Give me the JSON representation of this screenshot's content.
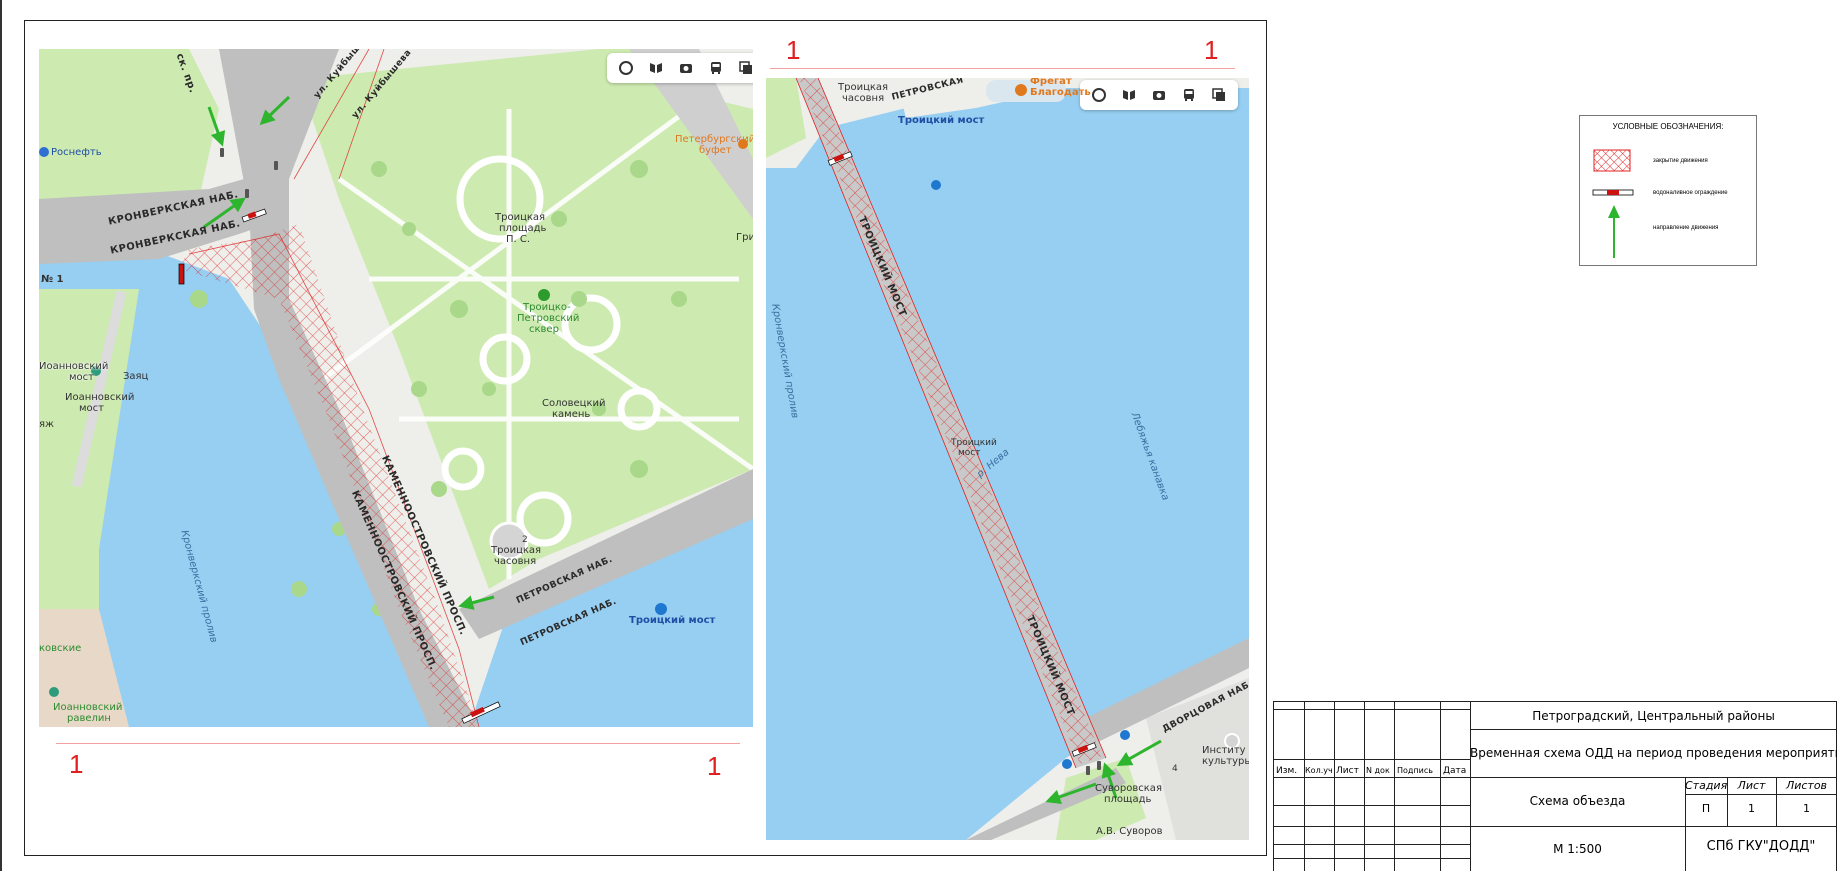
{
  "drawing": {
    "section_marks": {
      "top_left": "1",
      "top_right": "1",
      "bottom_left": "1",
      "bottom_right": "1"
    }
  },
  "map_controls": [
    "traffic-layer-icon",
    "panorama-icon",
    "photo-icon",
    "transit-icon",
    "layers-icon"
  ],
  "map_left": {
    "labels": {
      "kronverk_pr": "ск. пр.",
      "kuibysheva_1": "ул. Куйбышева",
      "kuibysheva_2": "ул. Куйбышева",
      "rosneft": "Роснефть",
      "petersburg_buffet_1": "Петербургский",
      "petersburg_buffet_2": "буфет",
      "gri": "Гри",
      "kronverk_nab_1": "КРОНВЕРКСКАЯ НАБ.",
      "kronverk_nab_2": "КРОНВЕРКСКАЯ НАБ.",
      "n1": "№ 1",
      "troitskaya_pl_1": "Троицкая",
      "troitskaya_pl_2": "площадь",
      "troitskaya_pl_3": "П. С.",
      "skver_1": "Троицко-",
      "skver_2": "Петровский",
      "skver_3": "сквер",
      "ioann_bridge_1": "Иоанновский",
      "ioann_bridge_2": "мост",
      "zayats": "Заяц",
      "ioann_most_1": "Иоанновский",
      "ioann_most_2": "мост",
      "yazh": "яж",
      "solovetsky_1": "Соловецкий",
      "solovetsky_2": "камень",
      "kronverk_proliv": "Кронверкский пролив",
      "kamennoostr_1": "КАМЕННООСТРОВСКИЙ ПРОСП.",
      "kamennoostr_2": "КАМЕННООСТРОВСКИЙ ПРОСП.",
      "chasovnya_1": "Троицкая",
      "chasovnya_2": "часовня",
      "petrovskaya_1": "ПЕТРОВСКАЯ НАБ.",
      "petrovskaya_2": "ПЕТРОВСКАЯ НАБ.",
      "troitsky_bridge": "Троицкий мост",
      "kronverkskie": "ковские",
      "ravelin_1": "Иоанновский",
      "ravelin_2": "равелин",
      "badge2": "2"
    }
  },
  "map_right": {
    "labels": {
      "chasovnya_1": "Троицкая",
      "chasovnya_2": "часовня",
      "petrovskaya": "ПЕТРОВСКАЯ",
      "fregat_1": "Фрегат",
      "fregat_2": "Благодать",
      "troitsky_bridge_top": "Троицкий мост",
      "bridge_upper": "ТРОИЦКИЙ МОСТ",
      "bridge_lower": "ТРОИЦКИЙ МОСТ",
      "kronverk_proliv": "Кронверкский пролив",
      "bridge_mid_1": "Троицкий",
      "bridge_mid_2": "мост",
      "neva": "р. Нева",
      "lebyazhya": "Лебяжья канавка",
      "dvortsovaya": "ДВОРЦОВАЯ НАБ.",
      "institut_1": "Институ",
      "institut_2": "культуры",
      "suvorov_pl_1": "Суворовская",
      "suvorov_pl_2": "площадь",
      "suvorov": "А.В. Суворов",
      "badge4": "4"
    }
  },
  "legend": {
    "title": "УСЛОВНЫЕ ОБОЗНАЧЕНИЯ:",
    "items": [
      {
        "label": "закрытие движения"
      },
      {
        "label": "водоналивное ограждение"
      },
      {
        "label": "направление движения"
      }
    ],
    "colors": {
      "closure": "#e02020",
      "arrow": "#2db52d",
      "barrier_red": "#cc1111"
    }
  },
  "stamp": {
    "headers": [
      "Изм.",
      "Кол.уч",
      "Лист",
      "N док",
      "Подпись",
      "Дата"
    ],
    "area": "Петроградский, Центральный районы",
    "title": "Временная схема ОДД на период проведения мероприятия",
    "sheet_name": "Схема объезда",
    "stage_header": "Стадия",
    "sheet_header": "Лист",
    "sheets_header": "Листов",
    "stage": "П",
    "sheet": "1",
    "sheets": "1",
    "scale": "М 1:500",
    "org": "СПб ГКУ\"ДОДД\""
  }
}
